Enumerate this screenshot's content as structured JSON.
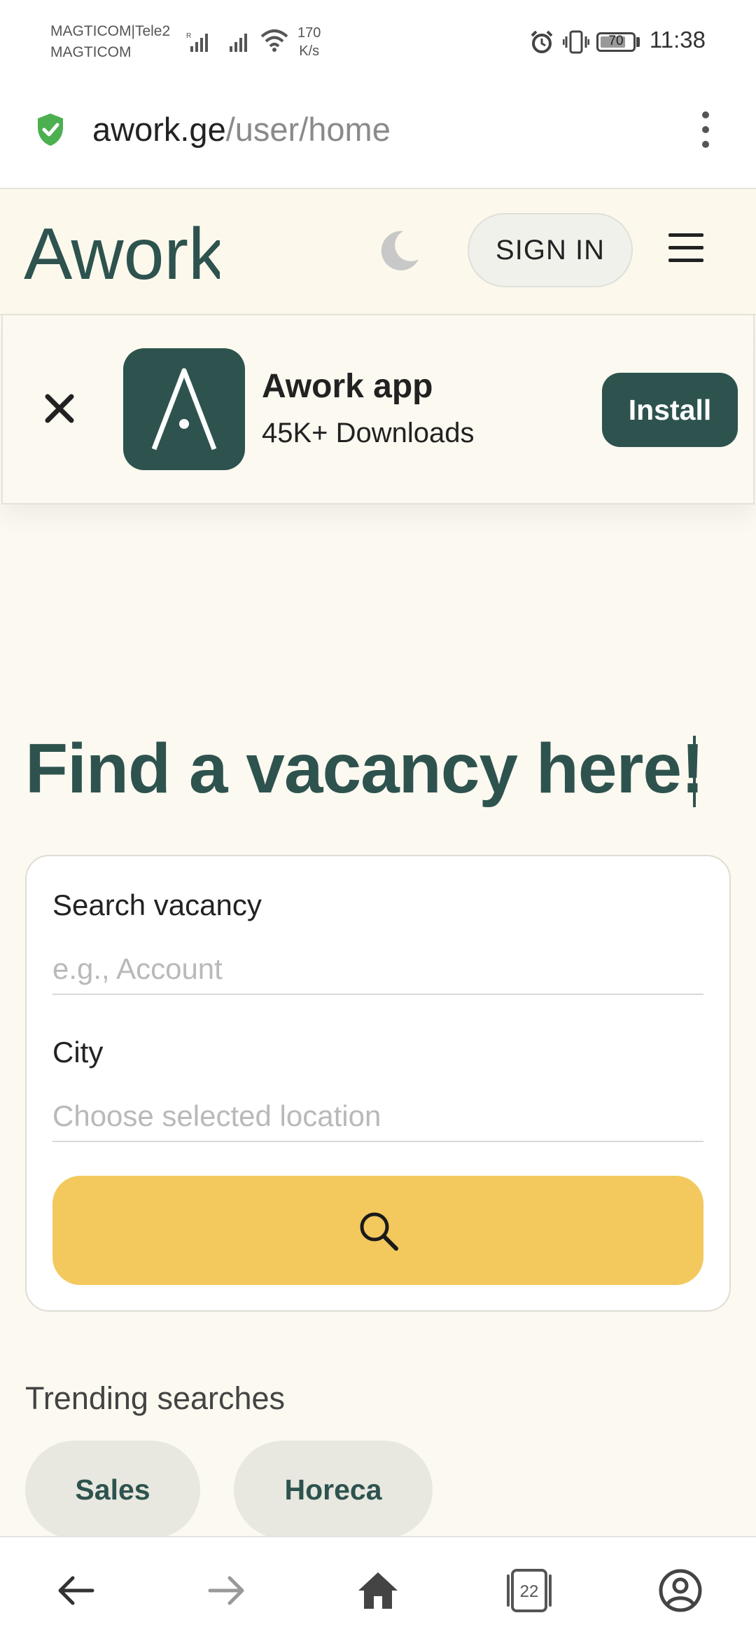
{
  "status_bar": {
    "carrier_line1": "MAGTICOM|Tele2",
    "carrier_line2": "MAGTICOM",
    "speed_value": "170",
    "speed_unit": "K/s",
    "battery": "70",
    "time": "11:38"
  },
  "browser": {
    "url_domain": "awork.ge",
    "url_path": "/user/home"
  },
  "header": {
    "logo_text": "Awork",
    "sign_in_label": "SIGN IN"
  },
  "app_banner": {
    "name": "Awork app",
    "downloads": "45K+ Downloads",
    "install_label": "Install"
  },
  "hero": {
    "title": "Find a vacancy here!"
  },
  "search": {
    "vacancy_label": "Search vacancy",
    "vacancy_placeholder": "e.g., Account",
    "city_label": "City",
    "city_placeholder": "Choose selected location"
  },
  "trending": {
    "title": "Trending searches",
    "chips": [
      "Sales",
      "Horeca"
    ]
  },
  "bottom_nav": {
    "tabs_count": "22"
  },
  "colors": {
    "brand": "#2e534f",
    "search_button": "#f3c95e",
    "background": "#fcf9f0"
  }
}
